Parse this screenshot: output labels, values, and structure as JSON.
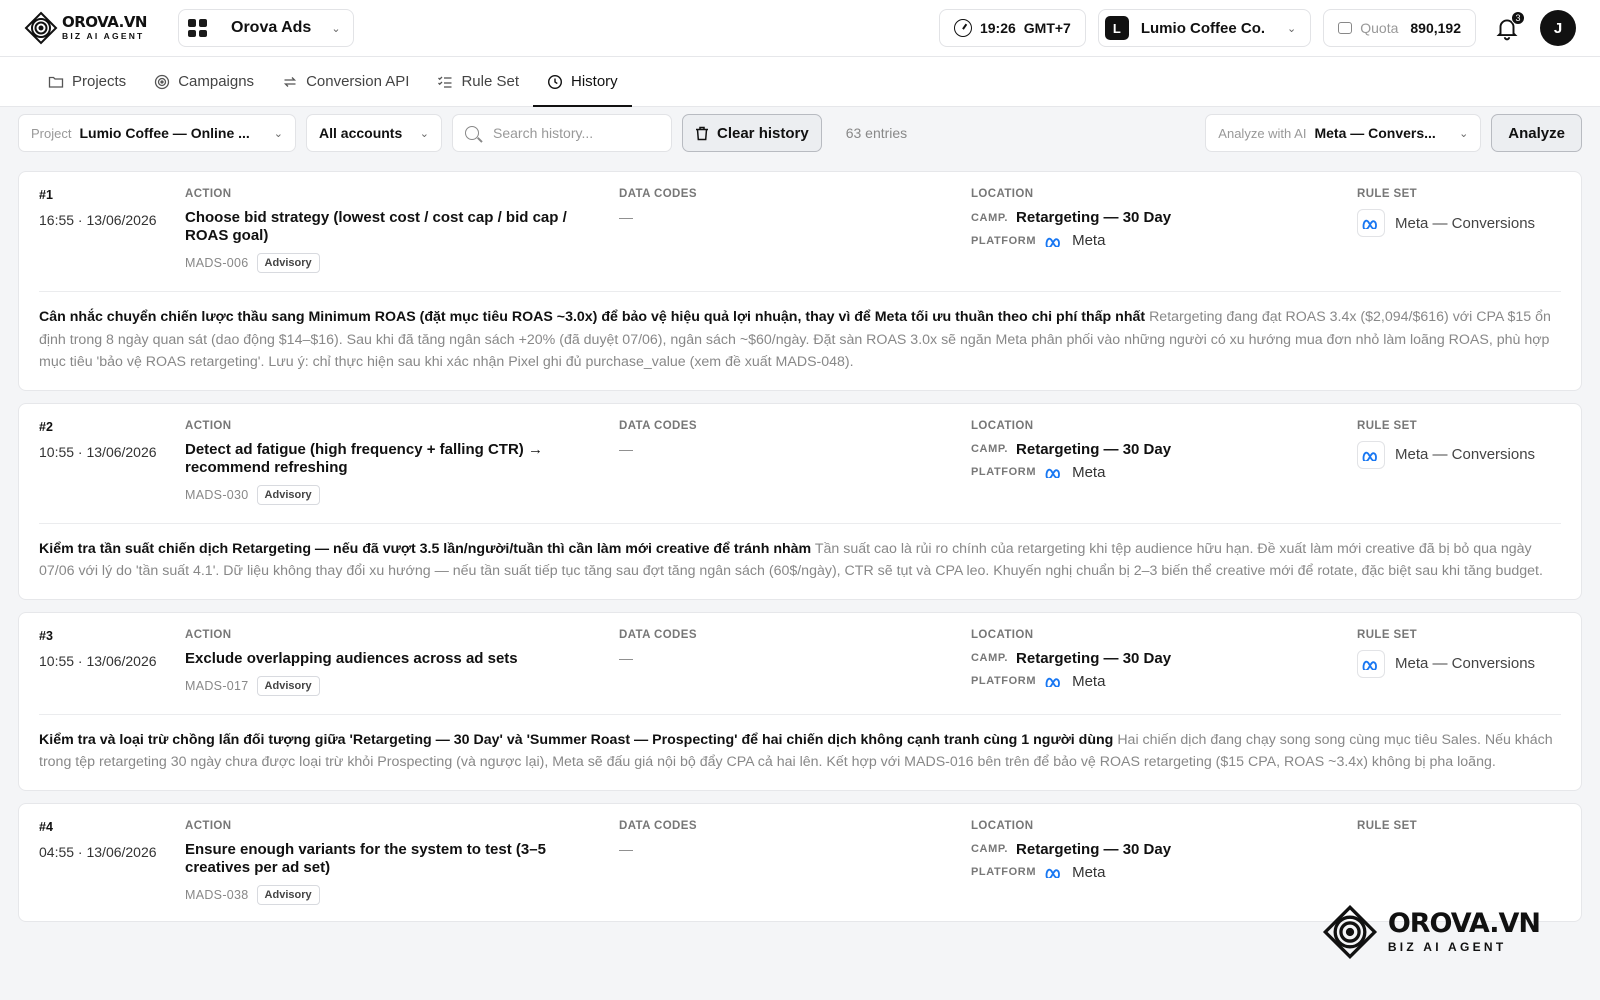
{
  "brand": {
    "logo_main": "OROVA.VN",
    "logo_sub": "BIZ AI AGENT"
  },
  "app": {
    "name": "Orova Ads"
  },
  "header": {
    "time": "19:26",
    "timezone": "GMT+7",
    "account_initial": "L",
    "account_name": "Lumio Coffee Co.",
    "quota_label": "Quota",
    "quota_value": "890,192",
    "notification_count": "3",
    "user_initial": "J"
  },
  "tabs": [
    {
      "label": "Projects",
      "icon": "folder-icon"
    },
    {
      "label": "Campaigns",
      "icon": "target-icon"
    },
    {
      "label": "Conversion API",
      "icon": "sync-icon"
    },
    {
      "label": "Rule Set",
      "icon": "checklist-icon"
    },
    {
      "label": "History",
      "icon": "clock-icon",
      "active": true
    }
  ],
  "toolbar": {
    "project_label": "Project",
    "project_value": "Lumio Coffee — Online ...",
    "accounts_value": "All accounts",
    "search_placeholder": "Search history...",
    "clear_label": "Clear history",
    "entries_text": "63 entries",
    "analyze_label": "Analyze with AI",
    "analyze_value": "Meta — Convers...",
    "analyze_button": "Analyze"
  },
  "columns": {
    "action": "ACTION",
    "data_codes": "DATA CODES",
    "location": "LOCATION",
    "rule_set": "RULE SET",
    "camp_key": "CAMP.",
    "platform_key": "PLATFORM"
  },
  "entries": [
    {
      "num": "#1",
      "time": "16:55 · 13/06/2026",
      "action": "Choose bid strategy (lowest cost / cost cap / bid cap / ROAS goal)",
      "code": "MADS-006",
      "tag": "Advisory",
      "data_codes": "—",
      "campaign": "Retargeting — 30 Day",
      "platform": "Meta",
      "rule_set": "Meta — Conversions",
      "headline": "Cân nhắc chuyển chiến lược thầu sang Minimum ROAS (đặt mục tiêu ROAS ~3.0x) để bảo vệ hiệu quả lợi nhuận, thay vì để Meta tối ưu thuần theo chi phí thấp nhất",
      "detail": "Retargeting đang đạt ROAS 3.4x ($2,094/$616) với CPA $15 ổn định trong 8 ngày quan sát (dao động $14–$16). Sau khi đã tăng ngân sách +20% (đã duyệt 07/06), ngân sách ~$60/ngày. Đặt sàn ROAS 3.0x sẽ ngăn Meta phân phối vào những người có xu hướng mua đơn nhỏ làm loãng ROAS, phù hợp mục tiêu 'bảo vệ ROAS retargeting'. Lưu ý: chỉ thực hiện sau khi xác nhận Pixel ghi đủ purchase_value (xem đề xuất MADS-048)."
    },
    {
      "num": "#2",
      "time": "10:55 · 13/06/2026",
      "action": "Detect ad fatigue (high frequency + falling CTR) → recommend refreshing",
      "code": "MADS-030",
      "tag": "Advisory",
      "data_codes": "—",
      "campaign": "Retargeting — 30 Day",
      "platform": "Meta",
      "rule_set": "Meta — Conversions",
      "headline": "Kiểm tra tần suất chiến dịch Retargeting — nếu đã vượt 3.5 lần/người/tuần thì cần làm mới creative để tránh nhàm",
      "detail": "Tần suất cao là rủi ro chính của retargeting khi tệp audience hữu hạn. Đề xuất làm mới creative đã bị bỏ qua ngày 07/06 với lý do 'tần suất 4.1'. Dữ liệu không thay đổi xu hướng — nếu tần suất tiếp tục tăng sau đợt tăng ngân sách (60$/ngày), CTR sẽ tụt và CPA leo. Khuyến nghị chuẩn bị 2–3 biến thể creative mới để rotate, đặc biệt sau khi tăng budget."
    },
    {
      "num": "#3",
      "time": "10:55 · 13/06/2026",
      "action": "Exclude overlapping audiences across ad sets",
      "code": "MADS-017",
      "tag": "Advisory",
      "data_codes": "—",
      "campaign": "Retargeting — 30 Day",
      "platform": "Meta",
      "rule_set": "Meta — Conversions",
      "headline": "Kiểm tra và loại trừ chồng lấn đối tượng giữa 'Retargeting — 30 Day' và 'Summer Roast — Prospecting' để hai chiến dịch không cạnh tranh cùng 1 người dùng",
      "detail": "Hai chiến dịch đang chạy song song cùng mục tiêu Sales. Nếu khách trong tệp retargeting 30 ngày chưa được loại trừ khỏi Prospecting (và ngược lại), Meta sẽ đấu giá nội bộ đẩy CPA cả hai lên. Kết hợp với MADS-016 bên trên để bảo vệ ROAS retargeting ($15 CPA, ROAS ~3.4x) không bị pha loãng."
    },
    {
      "num": "#4",
      "time": "04:55 · 13/06/2026",
      "action": "Ensure enough variants for the system to test (3–5 creatives per ad set)",
      "code": "MADS-038",
      "tag": "Advisory",
      "data_codes": "—",
      "campaign": "Retargeting — 30 Day",
      "platform": "Meta",
      "rule_set": "",
      "headline": "",
      "detail": ""
    }
  ]
}
